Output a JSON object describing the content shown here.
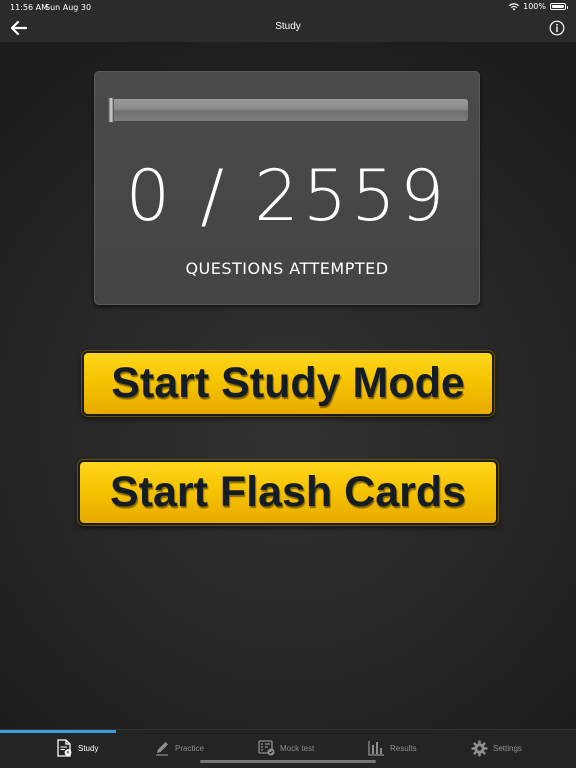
{
  "status_bar": {
    "time": "11:56 AM",
    "date": "Sun Aug 30",
    "battery": "100%"
  },
  "nav": {
    "title": "Study"
  },
  "progress": {
    "attempted": 0,
    "total": 2559,
    "count_text": "0 / 2559",
    "caption": "QUESTIONS ATTEMPTED"
  },
  "buttons": {
    "study_mode": "Start Study Mode",
    "flash_cards": "Start Flash Cards"
  },
  "tabs": [
    {
      "label": "Study",
      "icon": "study-doc-icon",
      "active": true
    },
    {
      "label": "Practice",
      "icon": "pencil-icon",
      "active": false
    },
    {
      "label": "Mock test",
      "icon": "mock-test-icon",
      "active": false
    },
    {
      "label": "Results",
      "icon": "bar-chart-icon",
      "active": false
    },
    {
      "label": "Settings",
      "icon": "gear-icon",
      "active": false
    }
  ],
  "colors": {
    "button_yellow": "#f6c400",
    "button_text": "#141c26",
    "tab_active_indicator": "#3a9ede",
    "background": "#222222"
  }
}
